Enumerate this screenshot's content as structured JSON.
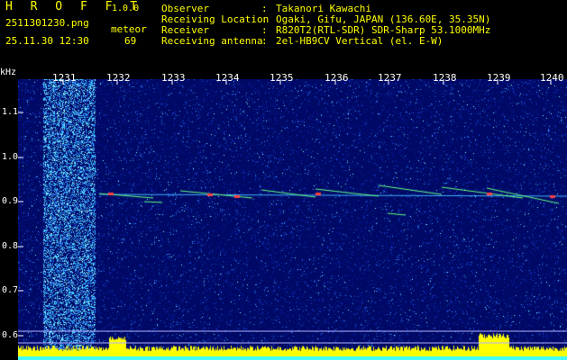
{
  "app": {
    "title": "H R O F F T",
    "version": "1.0.0"
  },
  "file": {
    "name": "2511301230.png",
    "datetime": "25.11.30 12:30"
  },
  "meteor": {
    "label": "meteor",
    "count": "69"
  },
  "info": {
    "observer": {
      "key": "Observer",
      "value": "Takanori Kawachi"
    },
    "location": {
      "key": "Receiving Location",
      "value": "Ogaki, Gifu, JAPAN (136.60E, 35.35N)"
    },
    "receiver": {
      "key": "Receiver",
      "value": "R820T2(RTL-SDR) SDR-Sharp 53.1000MHz"
    },
    "antenna": {
      "key": "Receiving antenna",
      "value": "2el-HB9CV Vertical (el. E-W)"
    },
    "colon": ":"
  },
  "axis": {
    "y_unit": "kHz",
    "y_ticks": [
      "1.1",
      "1.0",
      "0.9",
      "0.8",
      "0.7",
      "0.6"
    ],
    "x_ticks": [
      "1231",
      "1232",
      "1233",
      "1234",
      "1235",
      "1236",
      "1237",
      "1238",
      "1239",
      "1240"
    ]
  },
  "colors": {
    "header_text": "#ffff00",
    "info_text": "#ffffff",
    "background": "#000000",
    "spectrum_bg": "#000a66",
    "meteor_trace": "#ff4040",
    "level_bar": "#ffff00"
  }
}
